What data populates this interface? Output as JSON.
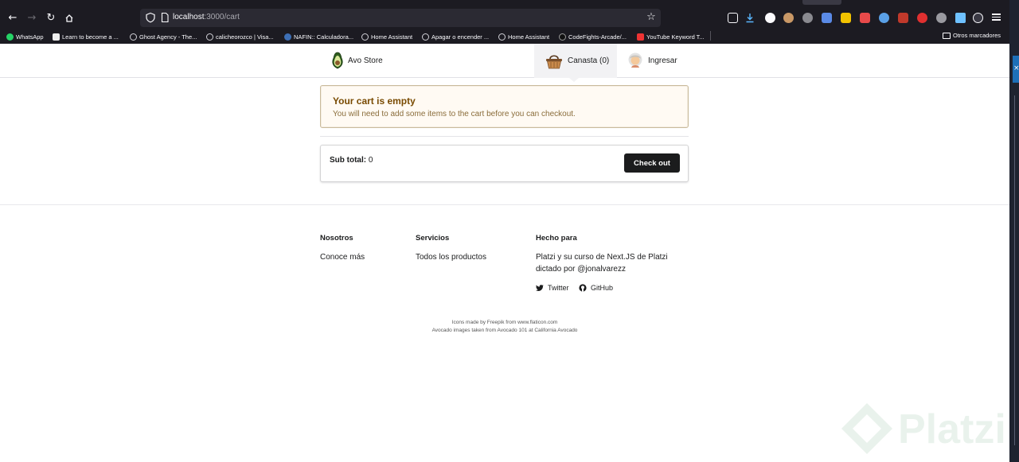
{
  "browser": {
    "url_host": "localhost",
    "url_path": ":3000/cart",
    "bookmarks": [
      {
        "label": "WhatsApp",
        "icon": "whatsapp-icon"
      },
      {
        "label": "Learn to become a ...",
        "icon": "bookmark-icon"
      },
      {
        "label": "Ghost Agency - The...",
        "icon": "globe-icon"
      },
      {
        "label": "calicheorozco | Visa...",
        "icon": "globe-icon"
      },
      {
        "label": "NAFIN:: Calculadora...",
        "icon": "globe-icon"
      },
      {
        "label": "Home Assistant",
        "icon": "globe-icon"
      },
      {
        "label": "Apagar o encender ...",
        "icon": "globe-icon"
      },
      {
        "label": "Home Assistant",
        "icon": "globe-icon"
      },
      {
        "label": "CodeFights-Arcade/...",
        "icon": "github-icon"
      },
      {
        "label": "YouTube Keyword T...",
        "icon": "youtube-icon"
      }
    ],
    "other_bookmarks": "Otros marcadores"
  },
  "header": {
    "brand": "Avo Store",
    "cart_label": "Canasta (0)",
    "login_label": "Ingresar"
  },
  "cart": {
    "empty_title": "Your cart is empty",
    "empty_message": "You will need to add some items to the cart before you can checkout.",
    "subtotal_label": "Sub total:",
    "subtotal_value": "0",
    "checkout_label": "Check out"
  },
  "footer": {
    "about_heading": "Nosotros",
    "about_link": "Conoce más",
    "services_heading": "Servicios",
    "services_link": "Todos los productos",
    "made_for_heading": "Hecho para",
    "made_for_line1": "Platzi y su curso de Next.JS de Platzi",
    "made_for_line2": "dictado por @jonalvarezz",
    "twitter": "Twitter",
    "github": "GitHub",
    "credit_icons": "Icons made by Freepik from www.flaticon.com",
    "credit_images": "Avocado images taken from Avocado 101 at California Avocado"
  },
  "watermark": "Platzi",
  "colors": {
    "alert_bg": "#fffaf3",
    "alert_title": "#794b02",
    "button_bg": "#1b1c1d",
    "chrome_bg": "#1c1b22"
  }
}
